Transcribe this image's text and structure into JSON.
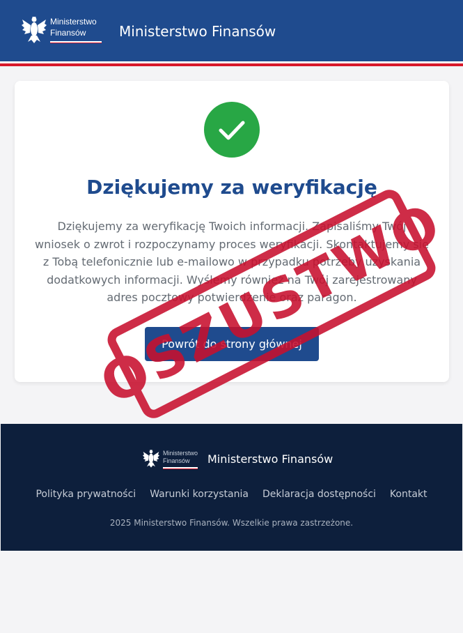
{
  "header": {
    "logo_text_line1": "Ministerstwo",
    "logo_text_line2": "Finansów",
    "site_title": "Ministerstwo Finansów"
  },
  "card": {
    "icon": "check-icon",
    "title": "Dziękujemy za weryfikację",
    "text": "Dziękujemy za weryfikację Twoich informacji. Zapisaliśmy Twój wniosek o zwrot i rozpoczynamy proces weryfikacji. Skontaktujemy się z Tobą telefonicznie lub e-mailowo w przypadku potrzeby uzyskania dodatkowych informacji. Wyślemy również na Twój zarejestrowany adres pocztowy potwierdzenie oraz paragon.",
    "button_label": "Powrót do strony głównej"
  },
  "stamp": {
    "text": "OSZUSTWO"
  },
  "footer": {
    "logo_text_line1": "Ministerstwo",
    "logo_text_line2": "Finansów",
    "title": "Ministerstwo Finansów",
    "links": [
      "Polityka prywatności",
      "Warunki korzystania",
      "Deklaracja dostępności",
      "Kontakt"
    ],
    "copyright": "2025 Ministerstwo Finansów. Wszelkie prawa zastrzeżone."
  },
  "colors": {
    "header_bg": "#1f4b8e",
    "accent_red": "#d8182b",
    "success_green": "#28a745",
    "footer_bg": "#0d1f3c",
    "stamp_red": "#c8102e"
  }
}
